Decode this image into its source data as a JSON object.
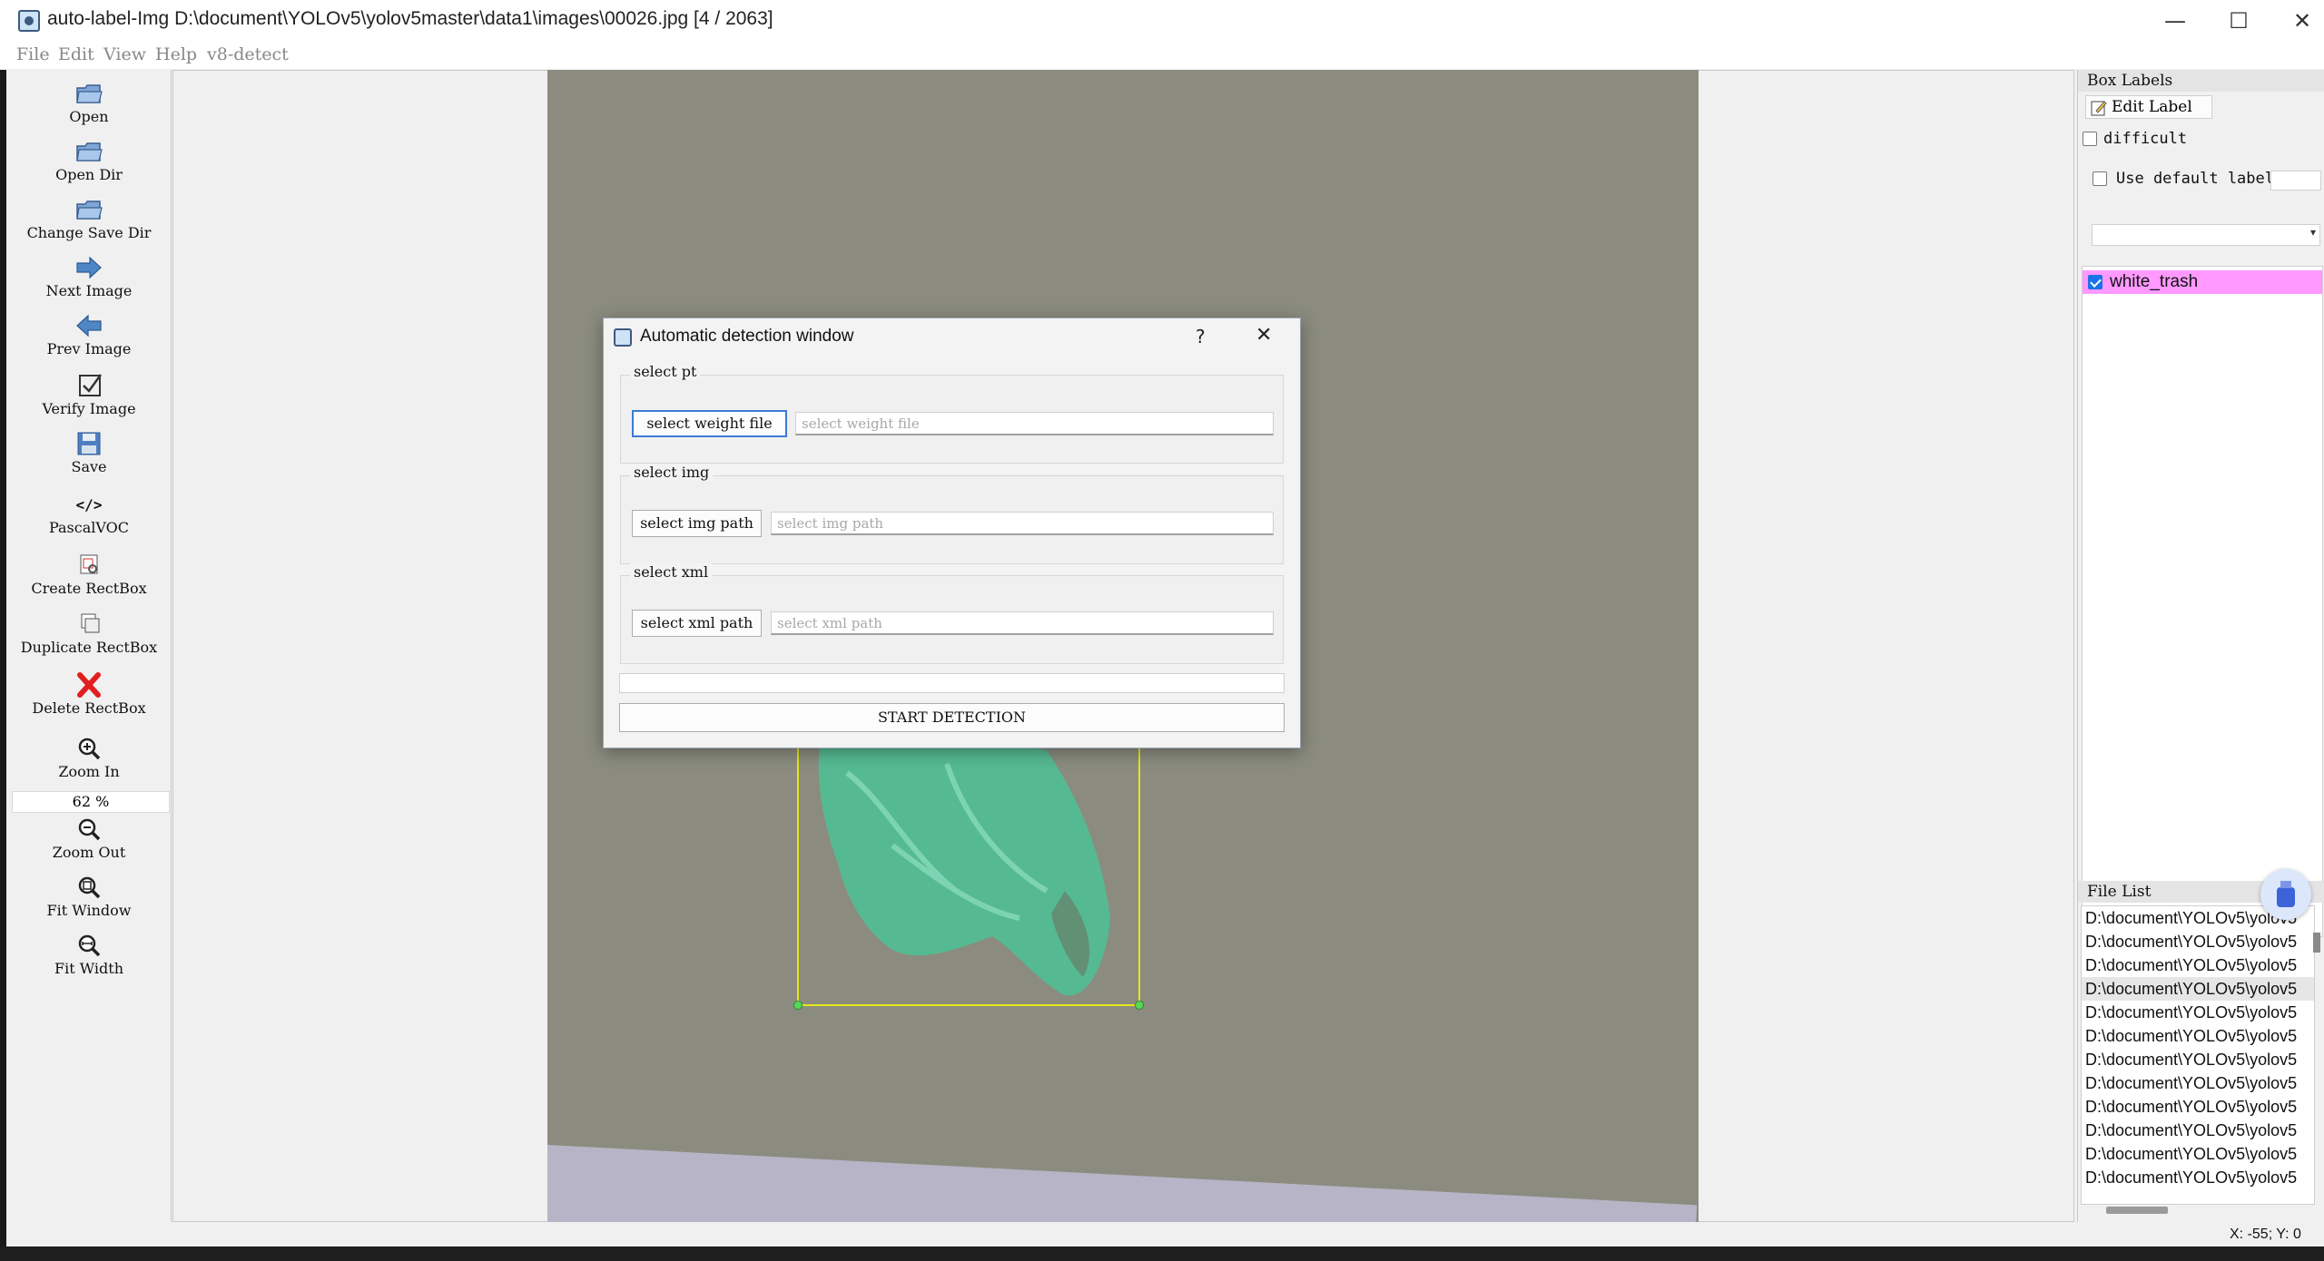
{
  "window": {
    "title": "auto-label-Img D:\\document\\YOLOv5\\yolov5master\\data1\\images\\00026.jpg [4 / 2063]",
    "minimize": "—",
    "maximize": "☐",
    "close": "✕"
  },
  "menu": [
    "File",
    "Edit",
    "View",
    "Help",
    "v8-detect"
  ],
  "toolbar": {
    "open": "Open",
    "open_dir": "Open Dir",
    "change_save_dir": "Change Save Dir",
    "next_image": "Next Image",
    "prev_image": "Prev Image",
    "verify_image": "Verify Image",
    "save": "Save",
    "format_icon": "</>",
    "format": "PascalVOC",
    "create_rectbox": "Create RectBox",
    "duplicate_rectbox": "Duplicate RectBox",
    "delete_rectbox": "Delete RectBox",
    "zoom_in": "Zoom In",
    "zoom_value": "62 %",
    "zoom_out": "Zoom Out",
    "fit_window": "Fit Window",
    "fit_width": "Fit Width"
  },
  "box_labels": {
    "header": "Box Labels",
    "edit_label": "Edit Label",
    "difficult": "difficult",
    "use_default_label": "Use default label",
    "labels": [
      {
        "name": "white_trash",
        "checked": true,
        "color": "#ff99ff"
      }
    ]
  },
  "file_list": {
    "header": "File List",
    "items": [
      "D:\\document\\YOLOv5\\yolov5",
      "D:\\document\\YOLOv5\\yolov5",
      "D:\\document\\YOLOv5\\yolov5",
      "D:\\document\\YOLOv5\\yolov5",
      "D:\\document\\YOLOv5\\yolov5",
      "D:\\document\\YOLOv5\\yolov5",
      "D:\\document\\YOLOv5\\yolov5",
      "D:\\document\\YOLOv5\\yolov5",
      "D:\\document\\YOLOv5\\yolov5",
      "D:\\document\\YOLOv5\\yolov5",
      "D:\\document\\YOLOv5\\yolov5",
      "D:\\document\\YOLOv5\\yolov5"
    ],
    "selected_index": 3
  },
  "status": {
    "coords": "X: -55; Y: 0"
  },
  "dialog": {
    "title": "Automatic detection window",
    "help": "?",
    "close": "✕",
    "groups": {
      "pt": {
        "title": "select pt",
        "button": "select weight file",
        "placeholder": "select weight file"
      },
      "img": {
        "title": "select img",
        "button": "select img path",
        "placeholder": "select img path"
      },
      "xml": {
        "title": "select xml",
        "button": "select xml path",
        "placeholder": "select xml path"
      }
    },
    "start": "START DETECTION"
  }
}
